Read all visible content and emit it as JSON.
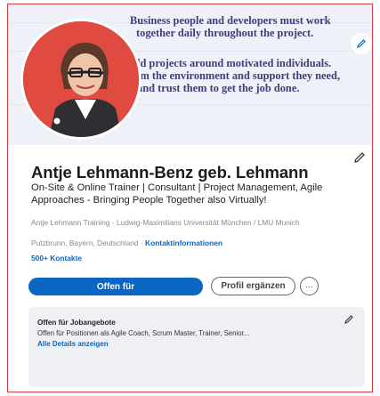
{
  "banner": {
    "quote_lines": [
      "Business people and developers must work",
      "together daily throughout the project.",
      "ld projects around motivated individuals.",
      "em the environment and support they need,",
      "and trust them to get the job done."
    ]
  },
  "profile": {
    "name": "Antje Lehmann-Benz geb. Lehmann",
    "headline": "On-Site & Online Trainer | Consultant | Project Management, Agile Approaches - Bringing People Together also Virtually!",
    "education": "Antje Lehmann Training · Ludwig-Maximilians Universität München / LMU Munich",
    "location": "Putzbrunn, Bayern, Deutschland ·",
    "contact_link": "Kontaktinformationen",
    "connections": "500+ Kontakte"
  },
  "actions": {
    "open_label": "Offen für",
    "add_profile_label": "Profil ergänzen",
    "more_label": "···"
  },
  "jobs": {
    "title": "Offen für Jobangebote",
    "description": "Offen für Positionen als Agile Coach, Scrum Master, Trainer, Senior...",
    "link": "Alle Details anzeigen"
  },
  "icons": {
    "edit": "pencil-icon",
    "more": "ellipsis-icon"
  },
  "colors": {
    "accent": "#0a66c2",
    "avatar_bg": "#df4a41",
    "banner_bg": "#eef1f7",
    "quote_text": "#3c3f7c",
    "frame_border": "#d93a3a"
  }
}
